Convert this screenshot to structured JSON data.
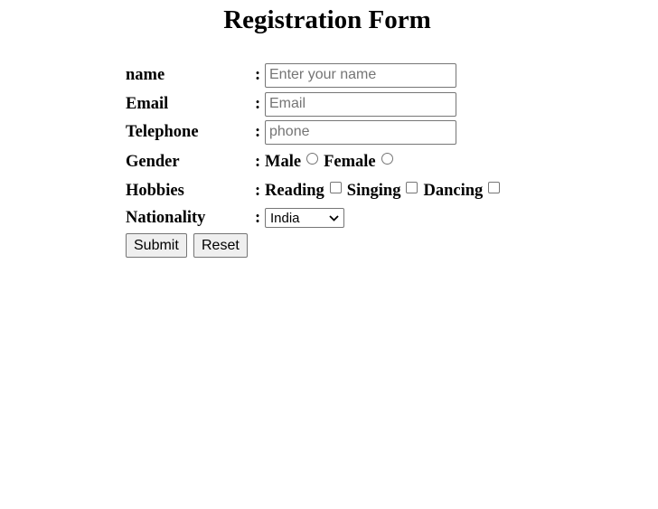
{
  "form": {
    "title": "Registration Form",
    "fields": {
      "name": {
        "label": "name",
        "placeholder": "Enter your name",
        "value": ""
      },
      "email": {
        "label": "Email",
        "placeholder": "Email",
        "value": ""
      },
      "telephone": {
        "label": "Telephone",
        "placeholder": "phone",
        "value": ""
      }
    },
    "colon": ":",
    "gender": {
      "label": "Gender",
      "options": [
        "Male",
        "Female"
      ]
    },
    "hobbies": {
      "label": "Hobbies",
      "options": [
        "Reading",
        "Singing",
        "Dancing"
      ]
    },
    "nationality": {
      "label": "Nationality",
      "selected": "India"
    },
    "buttons": {
      "submit": "Submit",
      "reset": "Reset"
    }
  }
}
